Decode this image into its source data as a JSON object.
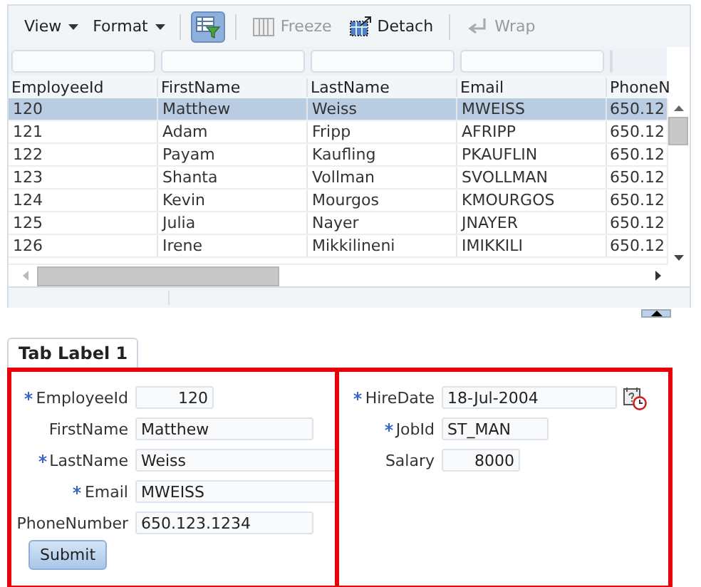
{
  "toolbar": [
    {
      "kind": "menu",
      "label": "View"
    },
    {
      "kind": "menu",
      "label": "Format"
    },
    {
      "kind": "toggle",
      "selected": true
    },
    {
      "kind": "button",
      "label": "Freeze",
      "disabled": true
    },
    {
      "kind": "button",
      "label": "Detach",
      "disabled": false
    },
    {
      "kind": "button",
      "label": "Wrap",
      "disabled": true
    }
  ],
  "table": {
    "columns": [
      "EmployeeId",
      "FirstName",
      "LastName",
      "Email",
      "PhoneN"
    ],
    "rows": [
      {
        "selected": true,
        "cells": [
          "120",
          "Matthew",
          "Weiss",
          "MWEISS",
          "650.12"
        ]
      },
      {
        "selected": false,
        "cells": [
          "121",
          "Adam",
          "Fripp",
          "AFRIPP",
          "650.12"
        ]
      },
      {
        "selected": false,
        "cells": [
          "122",
          "Payam",
          "Kaufling",
          "PKAUFLIN",
          "650.12"
        ]
      },
      {
        "selected": false,
        "cells": [
          "123",
          "Shanta",
          "Vollman",
          "SVOLLMAN",
          "650.12"
        ]
      },
      {
        "selected": false,
        "cells": [
          "124",
          "Kevin",
          "Mourgos",
          "KMOURGOS",
          "650.12"
        ]
      },
      {
        "selected": false,
        "cells": [
          "125",
          "Julia",
          "Nayer",
          "JNAYER",
          "650.12"
        ]
      },
      {
        "selected": false,
        "cells": [
          "126",
          "Irene",
          "Mikkilineni",
          "IMIKKILI",
          "650.12"
        ]
      }
    ]
  },
  "tabs": [
    {
      "label": "Tab Label 1",
      "selected": true
    }
  ],
  "form": {
    "columns": [
      [
        {
          "label": "EmployeeId",
          "required": true,
          "kind": "number",
          "value": "120"
        },
        {
          "label": "FirstName",
          "required": false,
          "kind": "text",
          "value": "Matthew"
        },
        {
          "label": "LastName",
          "required": true,
          "kind": "wide",
          "value": "Weiss"
        },
        {
          "label": "Email",
          "required": true,
          "kind": "wide",
          "value": "MWEISS"
        },
        {
          "label": "PhoneNumber",
          "required": false,
          "kind": "text",
          "value": "650.123.1234"
        }
      ],
      [
        {
          "label": "HireDate",
          "required": true,
          "kind": "date",
          "value": "18-Jul-2004"
        },
        {
          "label": "JobId",
          "required": true,
          "kind": "short",
          "value": "ST_MAN"
        },
        {
          "label": "Salary",
          "required": false,
          "kind": "number",
          "value": "8000"
        }
      ]
    ],
    "submit": "Submit"
  }
}
